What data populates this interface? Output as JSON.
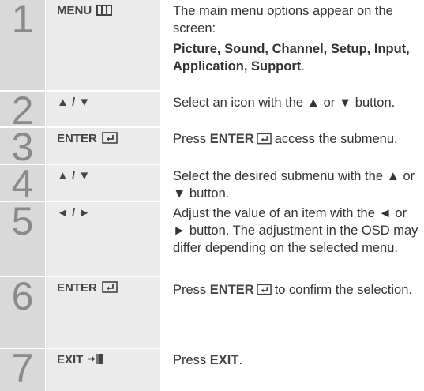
{
  "steps": [
    {
      "num": "1",
      "key": "MENU",
      "icon": "menu-icon",
      "desc_a": "The main menu options appear on the screen:",
      "desc_b": "Picture, Sound, Channel, Setup, Input, Application, Support",
      "desc_c": "."
    },
    {
      "num": "2",
      "key": "▲ / ▼",
      "desc_a": "Select an icon with the ▲ or ▼ button."
    },
    {
      "num": "3",
      "key": "ENTER",
      "icon": "enter-icon",
      "desc_a": "Press",
      "desc_b": "ENTER",
      "desc_c": "access the submenu."
    },
    {
      "num": "4",
      "key": "▲ / ▼",
      "desc_a": "Select the desired submenu with the ▲ or ▼ button."
    },
    {
      "num": "5",
      "key": "◄ / ►",
      "desc_a": "Adjust the value of an item with the ◄ or ► button. The adjustment in the OSD may differ depending on the selected menu."
    },
    {
      "num": "6",
      "key": "ENTER",
      "icon": "enter-icon",
      "desc_a": "Press",
      "desc_b": "ENTER",
      "desc_c": "to confirm the selection."
    },
    {
      "num": "7",
      "key": "EXIT",
      "icon": "exit-icon",
      "desc_a": "Press",
      "desc_b": "EXIT",
      "desc_c": "."
    }
  ]
}
